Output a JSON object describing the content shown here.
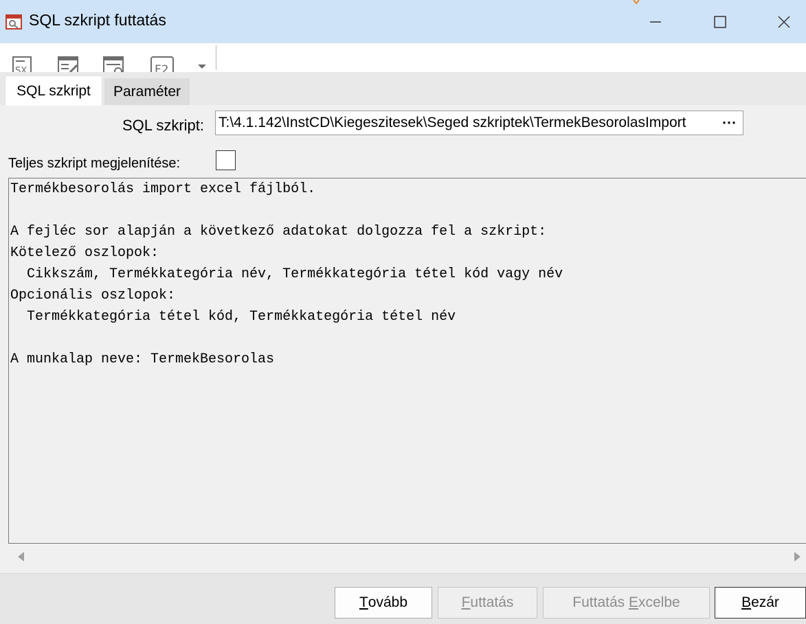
{
  "window": {
    "title": "SQL szkript futtatás",
    "minimize_glyph": "—",
    "maximize_glyph": "☐",
    "close_glyph": "✕"
  },
  "toolbar": {
    "buttons": [
      {
        "icon": "sql-script-icon"
      },
      {
        "icon": "edit-form-icon"
      },
      {
        "icon": "cancel-form-icon"
      },
      {
        "icon": "f2-key-icon",
        "label": "F2"
      }
    ],
    "dropdown_glyph": "▾"
  },
  "tabs": [
    {
      "label": "SQL szkript",
      "active": true
    },
    {
      "label": "Paraméter",
      "active": false
    }
  ],
  "form": {
    "sql_label": "SQL szkript:",
    "sql_path": "T:\\4.1.142\\InstCD\\Kiegeszitesek\\Seged szkriptek\\TermekBesorolasImport",
    "browse_glyph": "⋯",
    "full_script_label": "Teljes szkript megjelenítése:",
    "full_script_checked": false
  },
  "script_text": [
    "Termékbesorolás import excel fájlból.",
    "",
    "A fejléc sor alapján a következő adatokat dolgozza fel a szkript:",
    "Kötelező oszlopok:",
    "  Cikkszám, Termékkategória név, Termékkategória tétel kód vagy név",
    "Opcionális oszlopok:",
    "  Termékkategória tétel kód, Termékkategória tétel név",
    "",
    "A munkalap neve: TermekBesorolas"
  ],
  "footer": {
    "next": {
      "label": "Tovább",
      "mnemonic": "T",
      "rest": "ovább"
    },
    "run": {
      "label": "Futtatás",
      "mnemonic": "F",
      "rest": "uttatás",
      "disabled": true
    },
    "run_excel": {
      "label": "Futtatás Excelbe",
      "prefix": "Futtatás ",
      "mnemonic": "E",
      "rest": "xcelbe",
      "disabled": true
    },
    "close": {
      "label": "Bezár",
      "mnemonic": "B",
      "rest": "ezár"
    }
  },
  "colors": {
    "titlebar": "#cfe3f8",
    "accent": "#e8892b"
  }
}
